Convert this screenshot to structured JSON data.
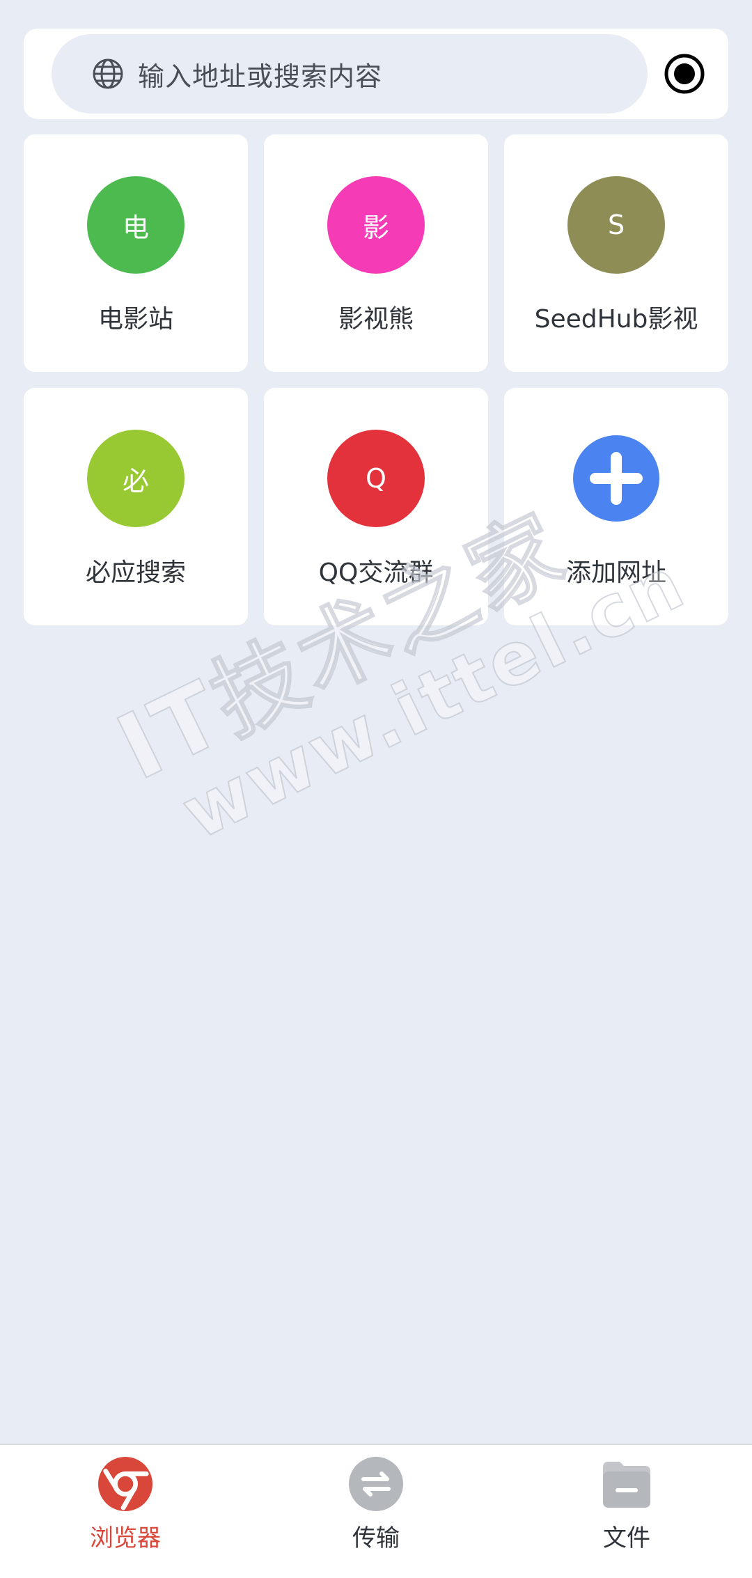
{
  "search": {
    "placeholder": "输入地址或搜索内容"
  },
  "colors": {
    "accent": "#d8473a",
    "background": "#e8ecf4"
  },
  "bookmarks": [
    {
      "initial": "电",
      "label": "电影站",
      "color": "#4dba4f"
    },
    {
      "initial": "影",
      "label": "影视熊",
      "color": "#f53cb6"
    },
    {
      "initial": "S",
      "label": "SeedHub影视",
      "color": "#8f8d56"
    },
    {
      "initial": "必",
      "label": "必应搜索",
      "color": "#98c932"
    },
    {
      "initial": "Q",
      "label": "QQ交流群",
      "color": "#e3323c"
    },
    {
      "initial": "",
      "label": "添加网址",
      "color": "#4b84f0",
      "icon": "plus-icon"
    }
  ],
  "watermark": {
    "line1": "IT技术之家",
    "line2": "www.ittel.cn"
  },
  "nav": {
    "items": [
      {
        "label": "浏览器",
        "icon": "browser-icon",
        "active": true
      },
      {
        "label": "传输",
        "icon": "transfer-icon",
        "active": false
      },
      {
        "label": "文件",
        "icon": "folder-icon",
        "active": false
      }
    ]
  }
}
